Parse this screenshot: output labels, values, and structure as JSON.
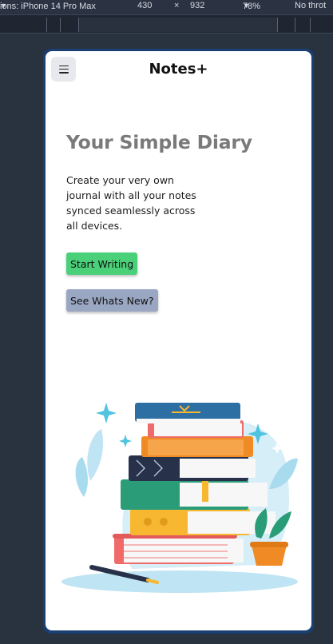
{
  "devtools": {
    "device_label": "ions: iPhone 14 Pro Max",
    "width": "430",
    "times": "×",
    "height": "932",
    "zoom": "78%",
    "throttle": "No throt"
  },
  "app": {
    "brand": "Notes+",
    "menu_icon": "hamburger-icon"
  },
  "hero": {
    "title": "Your Simple Diary",
    "description": "Create your very own journal with all your notes synced seamlessly across all devices."
  },
  "actions": {
    "start_label": "Start Writing",
    "whats_new_label": "See Whats New?"
  },
  "colors": {
    "start_button": "#4bd07a",
    "whats_new_button": "#9aa7c2",
    "title": "#7a7a7a",
    "devtools_bg": "#29323f"
  },
  "illustration": {
    "icon": "book-stack-illustration"
  }
}
